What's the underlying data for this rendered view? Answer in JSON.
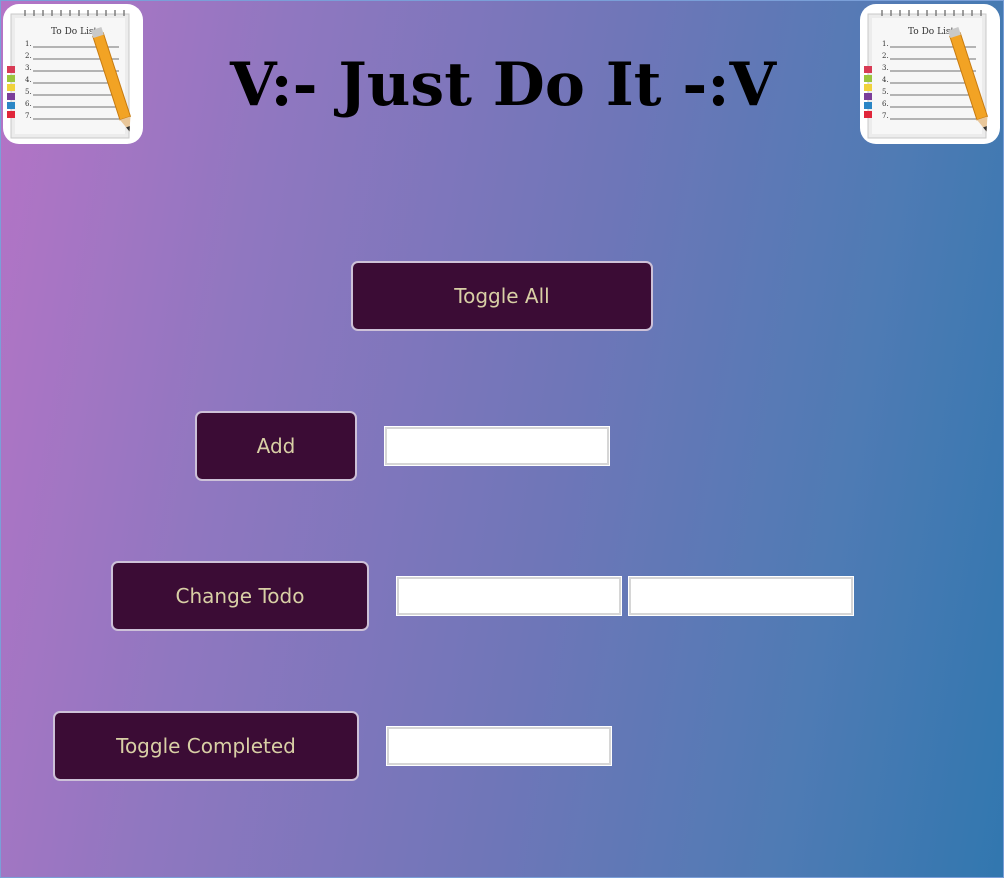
{
  "header": {
    "title": "V:- Just Do It -:V",
    "logo_icon": "todo-notepad-icon"
  },
  "logo_notepad": {
    "heading": "To Do List:",
    "lines": [
      "1.",
      "2.",
      "3.",
      "4.",
      "5.",
      "6.",
      "7."
    ]
  },
  "controls": {
    "toggle_all_label": "Toggle All",
    "add_label": "Add",
    "add_input_value": "",
    "change_todo_label": "Change Todo",
    "change_position_value": "",
    "change_text_value": "",
    "toggle_completed_label": "Toggle Completed",
    "toggle_completed_value": ""
  },
  "colors": {
    "button_bg": "#3b0c35",
    "button_text": "#d8cfa5",
    "gradient_left": "#b574c6",
    "gradient_right": "#3177af"
  }
}
